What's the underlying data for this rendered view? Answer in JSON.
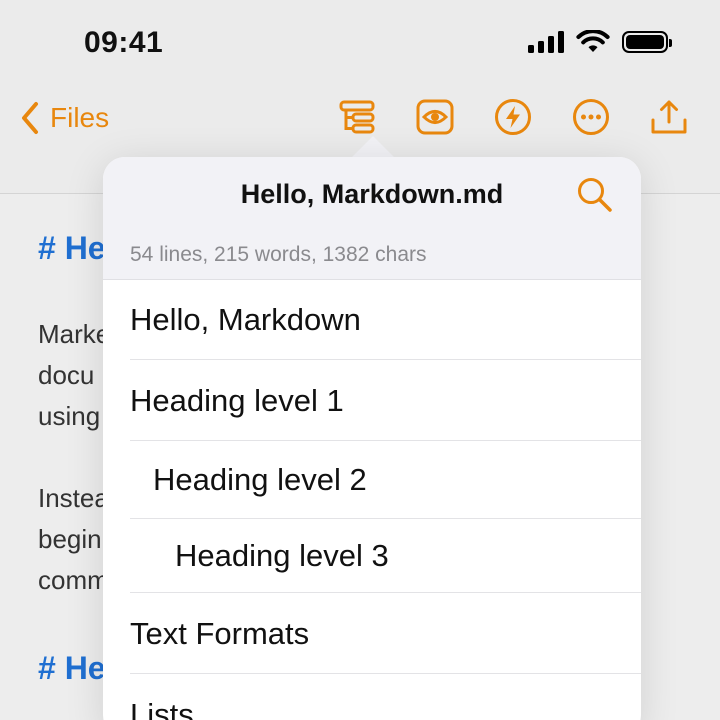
{
  "status_bar": {
    "time": "09:41",
    "icons": [
      "cellular-signal-icon",
      "wifi-icon",
      "battery-icon"
    ]
  },
  "nav_bar": {
    "back_label": "Files",
    "toolbar_icons": [
      "outline-icon",
      "preview-eye-icon",
      "bolt-icon",
      "more-icon",
      "share-icon"
    ],
    "accent_color": "#e8870e"
  },
  "document": {
    "headings": [
      "# He",
      "# He"
    ],
    "paragraphs": [
      "Marke\ndocu\nusing",
      "Instea\nbegin\ncomm"
    ],
    "heading_color": "#1f6fd1"
  },
  "popover": {
    "title": "Hello, Markdown.md",
    "stats": "54 lines, 215 words, 1382 chars",
    "outline": [
      {
        "label": "Hello, Markdown",
        "level": 1
      },
      {
        "label": "Heading level 1",
        "level": 1
      },
      {
        "label": "Heading level 2",
        "level": 2
      },
      {
        "label": "Heading level 3",
        "level": 3
      },
      {
        "label": "Text Formats",
        "level": 1
      },
      {
        "label": "Lists",
        "level": 1
      }
    ]
  }
}
